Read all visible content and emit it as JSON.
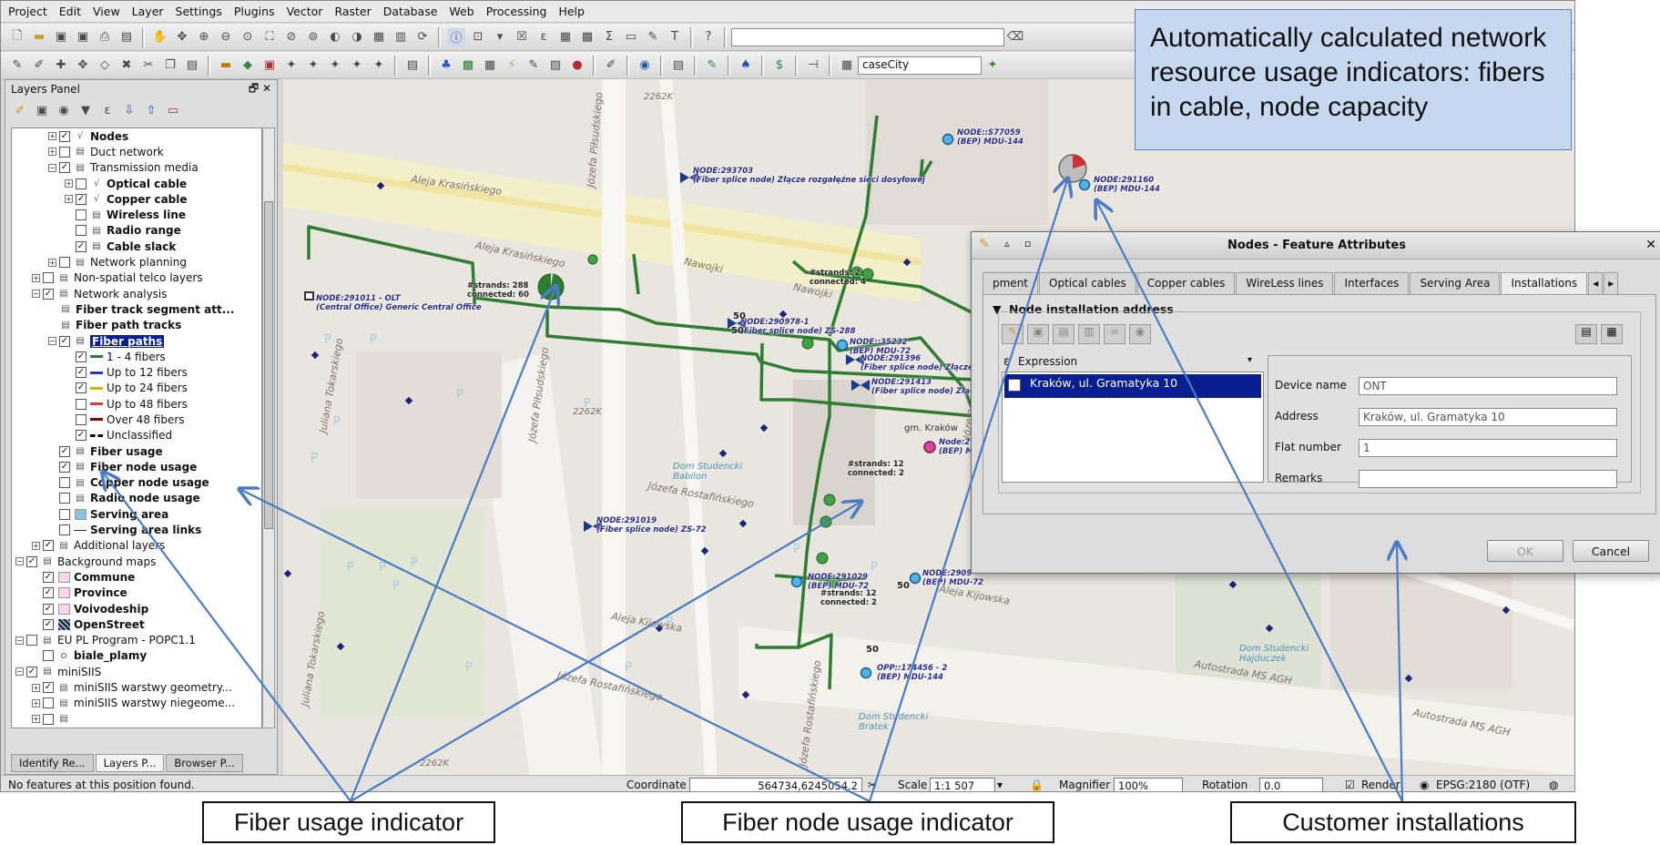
{
  "menubar": [
    "Project",
    "Edit",
    "View",
    "Layer",
    "Settings",
    "Plugins",
    "Vector",
    "Raster",
    "Database",
    "Web",
    "Processing",
    "Help"
  ],
  "toolbar": {
    "case_city": "caseCity"
  },
  "layers_panel": {
    "title": "Layers Panel",
    "items": [
      {
        "label": "Nodes",
        "indent": 2,
        "expand": "+",
        "checked": true,
        "bold": true
      },
      {
        "label": "Duct network",
        "indent": 2,
        "expand": "+",
        "checked": false
      },
      {
        "label": "Transmission media",
        "indent": 2,
        "expand": "-",
        "checked": true
      },
      {
        "label": "Optical cable",
        "indent": 3,
        "expand": "+",
        "checked": false,
        "bold": true
      },
      {
        "label": "Copper cable",
        "indent": 3,
        "expand": "+",
        "checked": true,
        "bold": true
      },
      {
        "label": "Wireless line",
        "indent": 3,
        "expand": "",
        "checked": false,
        "bold": true
      },
      {
        "label": "Radio range",
        "indent": 3,
        "expand": "",
        "checked": false,
        "bold": true
      },
      {
        "label": "Cable slack",
        "indent": 3,
        "expand": "",
        "checked": true,
        "bold": true
      },
      {
        "label": "Network planning",
        "indent": 2,
        "expand": "+",
        "checked": false
      },
      {
        "label": "Non-spatial telco layers",
        "indent": 1,
        "expand": "+",
        "checked": false
      },
      {
        "label": "Network analysis",
        "indent": 1,
        "expand": "-",
        "checked": true
      },
      {
        "label": "Fiber track segment att...",
        "indent": 2,
        "expand": "",
        "checked": null,
        "bold": true
      },
      {
        "label": "Fiber path tracks",
        "indent": 2,
        "expand": "",
        "checked": null,
        "bold": true
      },
      {
        "label": "Fiber paths",
        "indent": 2,
        "expand": "-",
        "checked": true,
        "selected": true
      },
      {
        "label": "1 - 4 fibers",
        "indent": 3,
        "expand": "",
        "checked": true,
        "legend": "#2e7d32"
      },
      {
        "label": "Up to 12 fibers",
        "indent": 3,
        "expand": "",
        "checked": true,
        "legend": "#1e3fbf"
      },
      {
        "label": "Up to 24 fibers",
        "indent": 3,
        "expand": "",
        "checked": true,
        "legend": "#e0b400"
      },
      {
        "label": "Up to 48 fibers",
        "indent": 3,
        "expand": "",
        "checked": false,
        "legend": "#e53935"
      },
      {
        "label": "Over 48 fibers",
        "indent": 3,
        "expand": "",
        "checked": false,
        "legend": "#8e0000"
      },
      {
        "label": "Unclassified",
        "indent": 3,
        "expand": "",
        "checked": true,
        "legend": "dash"
      },
      {
        "label": "Fiber usage",
        "indent": 2,
        "expand": "",
        "checked": true,
        "bold": true
      },
      {
        "label": "Fiber node usage",
        "indent": 2,
        "expand": "",
        "checked": true,
        "bold": true
      },
      {
        "label": "Copper node usage",
        "indent": 2,
        "expand": "",
        "checked": false,
        "bold": true
      },
      {
        "label": "Radio node usage",
        "indent": 2,
        "expand": "",
        "checked": false,
        "bold": true
      },
      {
        "label": "Serving area",
        "indent": 2,
        "expand": "",
        "checked": false,
        "bold": true,
        "swatch": "#87c5df"
      },
      {
        "label": "Serving area links",
        "indent": 2,
        "expand": "",
        "checked": false,
        "bold": true,
        "legend": "thin"
      },
      {
        "label": "Additional layers",
        "indent": 1,
        "expand": "+",
        "checked": true
      },
      {
        "label": "Background maps",
        "indent": 0,
        "expand": "-",
        "checked": true
      },
      {
        "label": "Commune",
        "indent": 1,
        "expand": "",
        "checked": true,
        "bold": true,
        "swatch": "#f7d7ea"
      },
      {
        "label": "Province",
        "indent": 1,
        "expand": "",
        "checked": true,
        "bold": true,
        "swatch": "#f7d7ea"
      },
      {
        "label": "Voivodeship",
        "indent": 1,
        "expand": "",
        "checked": true,
        "bold": true,
        "swatch": "#f7d7ea"
      },
      {
        "label": "OpenStreet",
        "indent": 1,
        "expand": "",
        "checked": true,
        "bold": true,
        "swatch": "grid"
      },
      {
        "label": "EU PL Program - POPC1.1",
        "indent": 0,
        "expand": "-",
        "checked": false
      },
      {
        "label": "biale_plamy",
        "indent": 1,
        "expand": "",
        "checked": false,
        "bold": true,
        "dot": true
      },
      {
        "label": "miniSIIS",
        "indent": 0,
        "expand": "-",
        "checked": true
      },
      {
        "label": "miniSIIS warstwy geometry...",
        "indent": 1,
        "expand": "+",
        "checked": true
      },
      {
        "label": "miniSIIS warstwy niegeome...",
        "indent": 1,
        "expand": "+",
        "checked": false
      },
      {
        "label": "",
        "indent": 1,
        "expand": "+",
        "checked": false
      }
    ],
    "tabs": [
      "Identify Re...",
      "Layers P...",
      "Browser P..."
    ]
  },
  "map": {
    "nodes": [
      {
        "text": "NODE::S77059\n(BEP) MDU-144"
      },
      {
        "text": "NODE:293703\n(Fiber splice node) Złącze rozgałęźne sieci dosyłowej"
      },
      {
        "text": "NODE:291160\n(BEP) MDU-144"
      },
      {
        "text": "NODE:291011 - OLT\n(Central Office) Generic Central Office"
      },
      {
        "text": "NODE:290978-1\n(Fiber splice node) ZS-288"
      },
      {
        "text": "NODE::35232\n(BEP) MDU-72"
      },
      {
        "text": "NODE:291396\n(Fiber splice node) Złącze r"
      },
      {
        "text": "NODE:291413\n(Fiber splice node) Złącz"
      },
      {
        "text": "Node:2\n(BEP) M"
      },
      {
        "text": "NODE:291019\n(Fiber splice node) ZS-72"
      },
      {
        "text": "NODE:291029\n(BEP) MDU-72"
      },
      {
        "text": "NODE:2909\n(BEP) MDU-72"
      },
      {
        "text": "OPP::174456 - 2\n(BEP) MDU-144"
      }
    ],
    "strands": [
      "#strands: 288\nconnected: 60",
      "#strands: 2\nconnected: 4",
      "#strands: 12\nconnected: 2",
      "#strands: 12\nconnected: 2"
    ],
    "fifty": [
      "50",
      "50",
      "50",
      "50"
    ],
    "streets": [
      "Aleja Krasińskiego",
      "Aleja Krasińskiego",
      "Nawojki",
      "Nawojki",
      "Józefa Piłsudskiego",
      "Józefa Piłsudskiego",
      "Józefa Rostafińskiego",
      "Józefa Rostafińskiego",
      "Aleja Kijowska",
      "Aleja Kijowska",
      "Juliana Tokarskiego",
      "Juliana Tokarskiego",
      "Autostrada MS AGH",
      "Autostrada MS AGH",
      "Józefa Rostafińskiego",
      "Józefa Rostafińskiego",
      "2262K",
      "2262K",
      "2262K",
      "gm. Kraków",
      "Dom Studencki Babilon",
      "Dom Studencki Hajduczek",
      "Dom Studencki Bratek"
    ]
  },
  "statusbar": {
    "message": "No features at this position found.",
    "coordinate_label": "Coordinate",
    "coordinate_value": "564734,6245054.2",
    "scale_label": "Scale",
    "scale_value": "1:1 507",
    "magnifier_label": "Magnifier",
    "magnifier_value": "100%",
    "rotation_label": "Rotation",
    "rotation_value": "0.0",
    "render_label": "Render",
    "crs": "EPSG:2180 (OTF)"
  },
  "dialog": {
    "title": "Nodes - Feature Attributes",
    "tabs": [
      "pment",
      "Optical cables",
      "Copper cables",
      "WireLess lines",
      "Interfaces",
      "Serving Area",
      "Installations"
    ],
    "active_tab": 6,
    "group_title": "Node installation address",
    "expression_label": "Expression",
    "list_items": [
      "Kraków, ul. Gramatyka 10"
    ],
    "fields": {
      "device_name_label": "Device name",
      "device_name_value": "ONT",
      "address_label": "Address",
      "address_value": "Kraków, ul. Gramatyka 10",
      "flat_label": "Flat number",
      "flat_value": "1",
      "remarks_label": "Remarks",
      "remarks_value": ""
    },
    "ok_label": "OK",
    "cancel_label": "Cancel"
  },
  "callouts": {
    "top": "Automatically calculated network resource usage indicators: fibers in cable, node capacity",
    "fiber_usage": "Fiber usage indicator",
    "fiber_node_usage": "Fiber node usage indicator",
    "customer_installations": "Customer installations"
  },
  "colors": {
    "fiber_green": "#2e7d32",
    "callout_bg": "#c5d8ef",
    "arrow_blue": "#4a7bc4",
    "selection_navy": "#0a1f8f"
  }
}
